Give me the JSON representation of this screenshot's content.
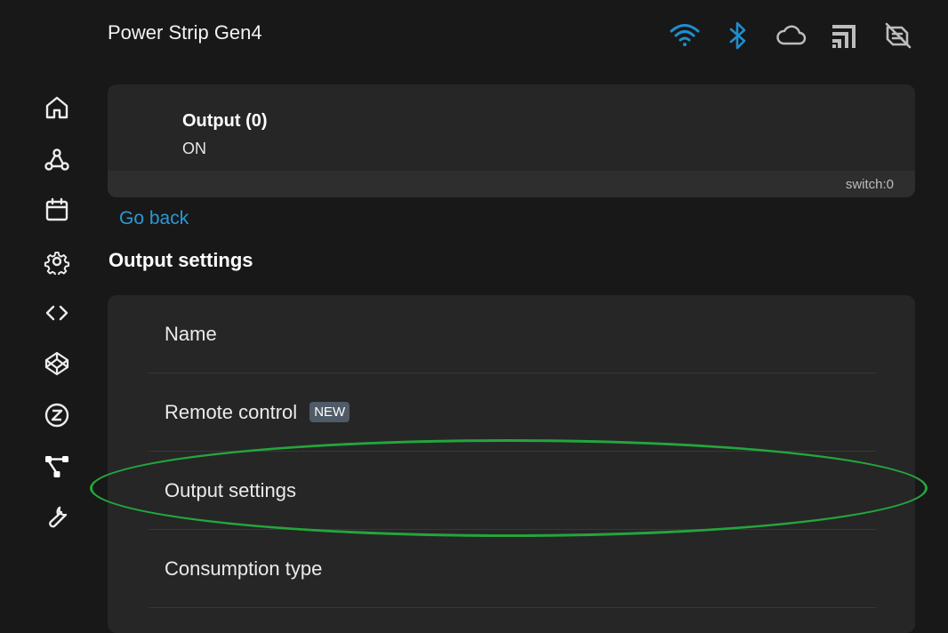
{
  "header": {
    "title": "Power Strip Gen4",
    "status_icons": [
      "wifi-icon",
      "bluetooth-icon",
      "cloud-icon",
      "rss-icon",
      "scheduler-off-icon"
    ]
  },
  "sidebar": {
    "items": [
      {
        "icon": "home-icon"
      },
      {
        "icon": "webhooks-icon"
      },
      {
        "icon": "calendar-icon"
      },
      {
        "icon": "gear-icon"
      },
      {
        "icon": "code-icon"
      },
      {
        "icon": "codepen-icon"
      },
      {
        "icon": "z-circle-icon"
      },
      {
        "icon": "hierarchy-icon"
      },
      {
        "icon": "wrench-icon"
      }
    ]
  },
  "output": {
    "name": "Output (0)",
    "state": "ON",
    "id": "switch:0"
  },
  "nav": {
    "go_back": "Go back"
  },
  "section": {
    "heading": "Output settings"
  },
  "settings": {
    "items": [
      {
        "label": "Name"
      },
      {
        "label": "Remote control",
        "badge": "NEW"
      },
      {
        "label": "Output settings"
      },
      {
        "label": "Consumption type"
      }
    ]
  },
  "colors": {
    "background": "#181818",
    "card": "#262626",
    "accent": "#2a98d6",
    "icon_active": "#1e8fcf",
    "icon_inactive": "#bdbdbd",
    "highlight": "#23a63d",
    "badge": "#4f5b66"
  }
}
